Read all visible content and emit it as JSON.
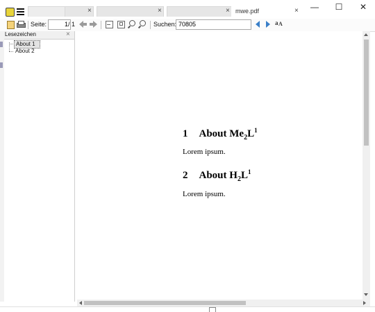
{
  "window": {
    "tab_title": "mwe.pdf",
    "min_glyph": "—",
    "max_glyph": "☐",
    "close_glyph": "✕"
  },
  "toolbar": {
    "page_label": "Seite:",
    "page_value": "1",
    "page_total": "/ 1",
    "search_label": "Suchen:",
    "search_value": "70805"
  },
  "sidebar": {
    "title": "Lesezeichen",
    "close_glyph": "×",
    "items": [
      {
        "label": "About 1"
      },
      {
        "label": "About 2"
      }
    ]
  },
  "document": {
    "sections": [
      {
        "number": "1",
        "title_pre": "About Me",
        "sub": "2",
        "title_post": "L",
        "sup": "1",
        "body": "Lorem ipsum."
      },
      {
        "number": "2",
        "title_pre": "About H",
        "sub": "2",
        "title_post": "L",
        "sup": "1",
        "body": "Lorem ipsum."
      }
    ]
  },
  "colors": {
    "accent_blue": "#3a7fc8",
    "logo_yellow": "#e8d43a"
  }
}
